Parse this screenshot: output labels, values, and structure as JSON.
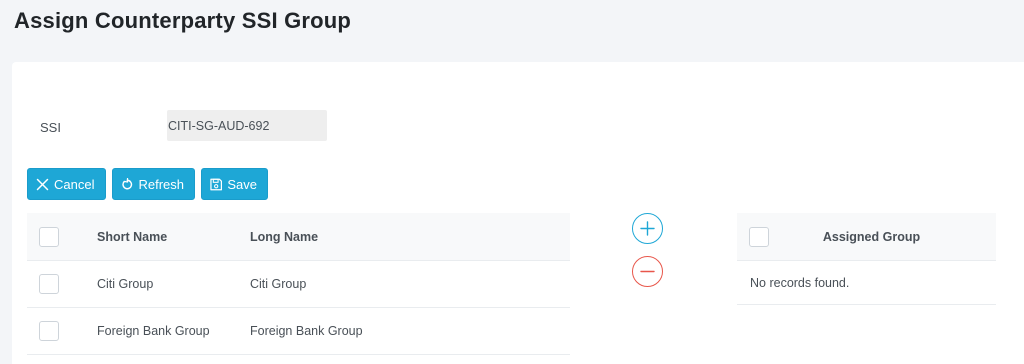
{
  "page": {
    "title": "Assign Counterparty SSI Group"
  },
  "ssi": {
    "label": "SSI",
    "value": "CITI-SG-AUD-692"
  },
  "toolbar": {
    "cancel_label": "Cancel",
    "refresh_label": "Refresh",
    "save_label": "Save",
    "cancel_icon": "close-icon",
    "refresh_icon": "refresh-icon",
    "save_icon": "floppy-disk-icon"
  },
  "available_table": {
    "headers": {
      "short_name": "Short Name",
      "long_name": "Long Name"
    },
    "rows": [
      {
        "short_name": "Citi Group",
        "long_name": "Citi Group"
      },
      {
        "short_name": "Foreign Bank Group",
        "long_name": "Foreign Bank Group"
      }
    ]
  },
  "assigned_table": {
    "header": "Assigned Group",
    "empty_message": "No records found."
  },
  "transfer": {
    "add_icon": "plus-circle-icon",
    "remove_icon": "minus-circle-icon"
  },
  "colors": {
    "accent": "#1ea7d6",
    "danger": "#e8564a",
    "page_background": "#f3f5f8",
    "header_background": "#f8f9fa",
    "readonly_field": "#eeeeee"
  }
}
